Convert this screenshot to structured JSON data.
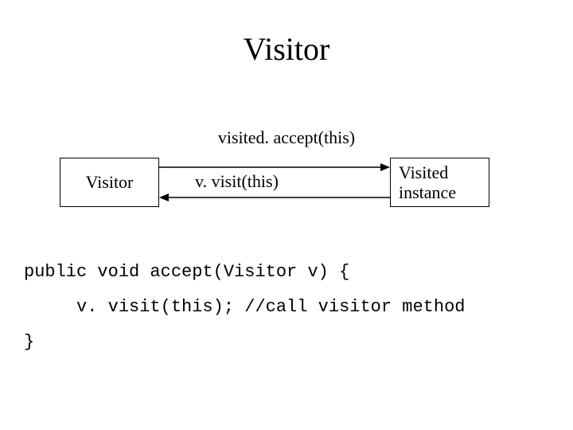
{
  "title": "Visitor",
  "diagram": {
    "topArrowLabel": "visited. accept(this)",
    "midArrowLabel": "v. visit(this)",
    "leftBox": "Visitor",
    "rightBox": "Visited instance"
  },
  "code": {
    "line1": "public void accept(Visitor v) {",
    "line2": "     v. visit(this); //call visitor method",
    "line3": "}"
  }
}
